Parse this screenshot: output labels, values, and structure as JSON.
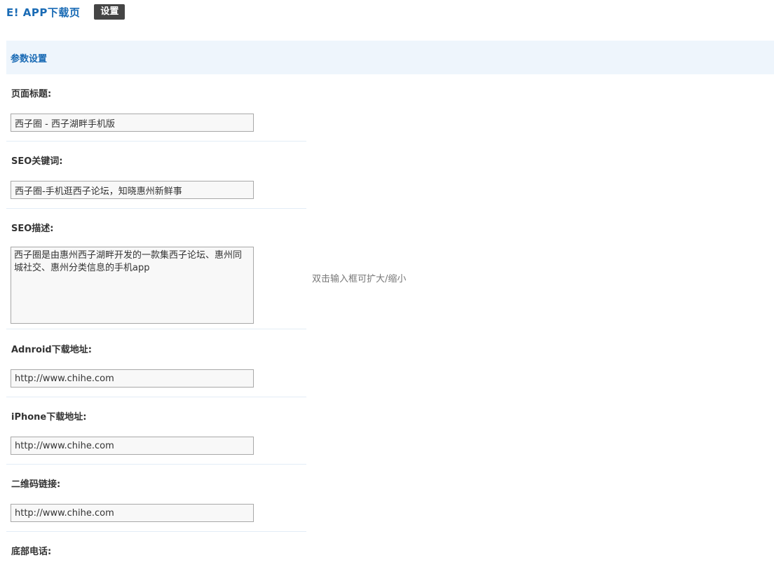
{
  "header": {
    "title": "E! APP下载页",
    "tab_settings": "设置"
  },
  "section": {
    "title": "参数设置"
  },
  "fields": {
    "page_title": {
      "label": "页面标题:",
      "value": "西子圈 - 西子湖畔手机版"
    },
    "seo_keywords": {
      "label": "SEO关键词:",
      "value": "西子圈-手机逛西子论坛，知晓惠州新鲜事"
    },
    "seo_description": {
      "label": "SEO描述:",
      "value": "西子圈是由惠州西子湖畔开发的一款集西子论坛、惠州同城社交、惠州分类信息的手机app",
      "hint": "双击输入框可扩大/缩小"
    },
    "android_url": {
      "label": "Adnroid下载地址:",
      "value": "http://www.chihe.com"
    },
    "iphone_url": {
      "label": "iPhone下载地址:",
      "value": "http://www.chihe.com"
    },
    "qrcode_url": {
      "label": "二维码链接:",
      "value": "http://www.chihe.com"
    },
    "footer_phone": {
      "label": "底部电话:"
    }
  }
}
